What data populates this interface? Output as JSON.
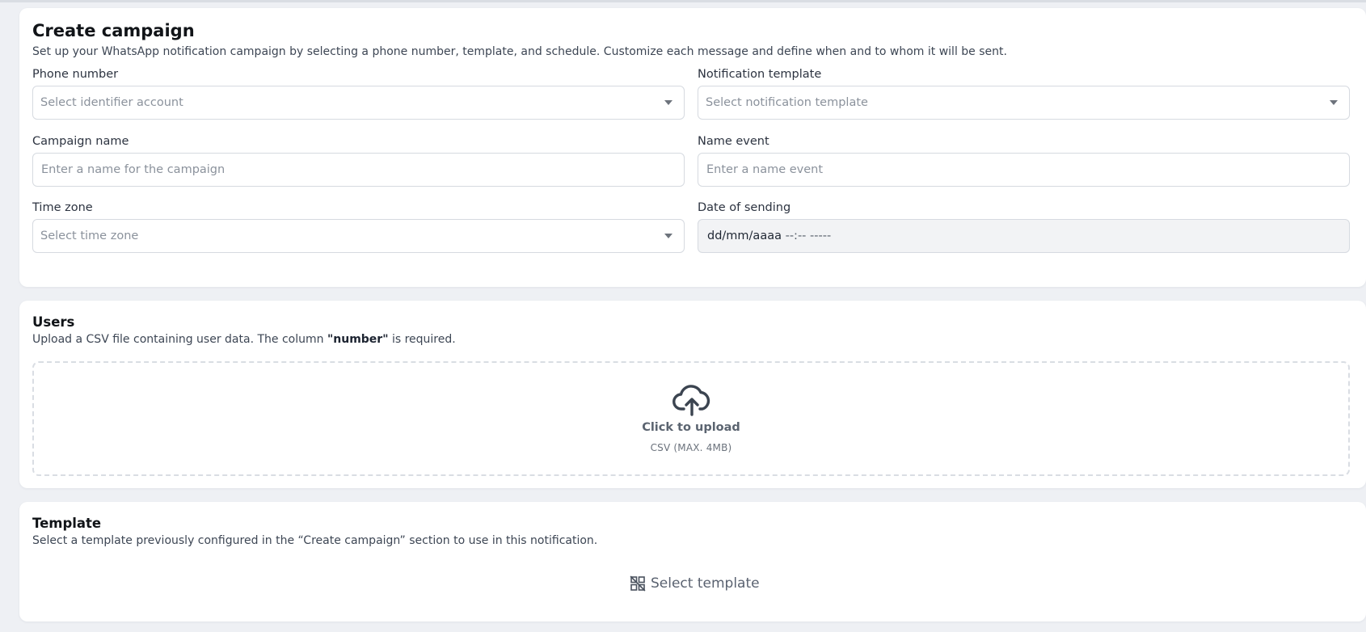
{
  "campaign": {
    "title": "Create campaign",
    "description": "Set up your WhatsApp notification campaign by selecting a phone number, template, and schedule. Customize each message and define when and to whom it will be sent.",
    "phone_number": {
      "label": "Phone number",
      "placeholder": "Select identifier account"
    },
    "notification_template": {
      "label": "Notification template",
      "placeholder": "Select notification template"
    },
    "campaign_name": {
      "label": "Campaign name",
      "placeholder": "Enter a name for the campaign"
    },
    "name_event": {
      "label": "Name event",
      "placeholder": "Enter a name event"
    },
    "time_zone": {
      "label": "Time zone",
      "placeholder": "Select time zone"
    },
    "date_of_sending": {
      "label": "Date of sending",
      "date_part": "dd/mm/aaaa",
      "time_part": "--:-- -----"
    }
  },
  "users": {
    "title": "Users",
    "description_prefix": "Upload a CSV file containing user data. The column ",
    "description_bold": "\"number\"",
    "description_suffix": " is required.",
    "upload_title": "Click to upload",
    "upload_hint": "CSV (MAX. 4MB)"
  },
  "template": {
    "title": "Template",
    "description": "Select a template previously configured in the “Create campaign” section to use in this notification.",
    "select_label": "Select template"
  },
  "icons": {
    "upload": "cloud-upload-icon",
    "template": "template-icon",
    "dropdown": "chevron-down-icon"
  },
  "colors": {
    "background": "#eef0f4",
    "card": "#ffffff",
    "border": "#d6dae0",
    "placeholder": "#8b929c",
    "icon": "#3b4450"
  }
}
